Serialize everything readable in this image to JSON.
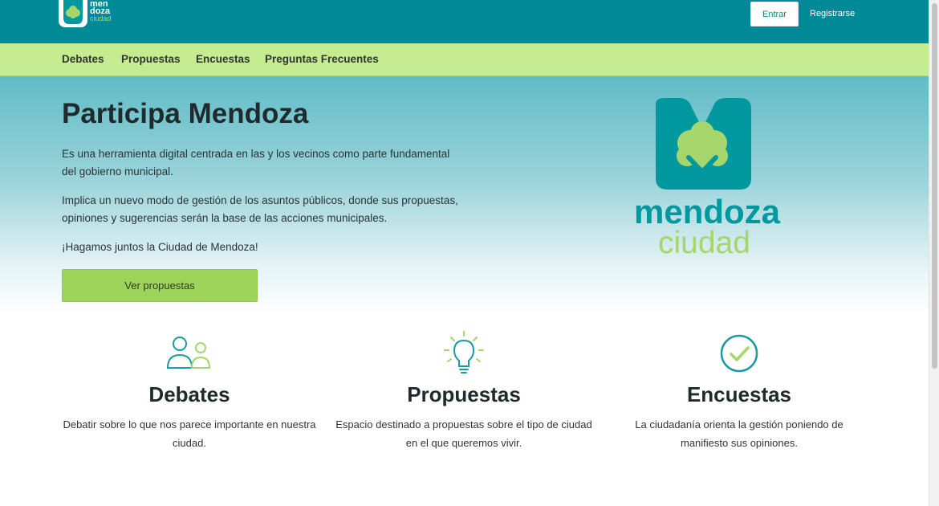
{
  "header": {
    "logo_words": [
      "men",
      "doza",
      "ciudad"
    ],
    "login_label": "Entrar",
    "register_label": "Registrarse"
  },
  "subnav": {
    "items": [
      "Debates",
      "Propuestas",
      "Encuestas",
      "Preguntas Frecuentes"
    ]
  },
  "hero": {
    "title": "Participa Mendoza",
    "paragraphs": [
      "Es una herramienta digital centrada en las y los vecinos como parte fundamental del gobierno municipal.",
      "Implica un nuevo modo de gestión de los asuntos públicos, donde sus propuestas, opiniones y sugerencias serán la base de las acciones municipales.",
      "¡Hagamos juntos la Ciudad de Mendoza!"
    ],
    "cta_label": "Ver propuestas",
    "logo_text_1": "mendoza",
    "logo_text_2": "ciudad"
  },
  "features": [
    {
      "icon": "people-icon",
      "title": "Debates",
      "text": "Debatir sobre lo que nos parece importante en nuestra ciudad."
    },
    {
      "icon": "lightbulb-icon",
      "title": "Propuestas",
      "text": "Espacio destinado a propuestas sobre el tipo de ciudad en el que queremos vivir."
    },
    {
      "icon": "check-circle-icon",
      "title": "Encuestas",
      "text": "La ciudadanía orienta la gestión poniendo de manifiesto sus opiniones."
    }
  ],
  "colors": {
    "topbar": "#008996",
    "subnav": "#c6ec92",
    "accent_green": "#9ed45a",
    "logo_teal": "#00989f",
    "logo_green": "#a6d56c"
  }
}
